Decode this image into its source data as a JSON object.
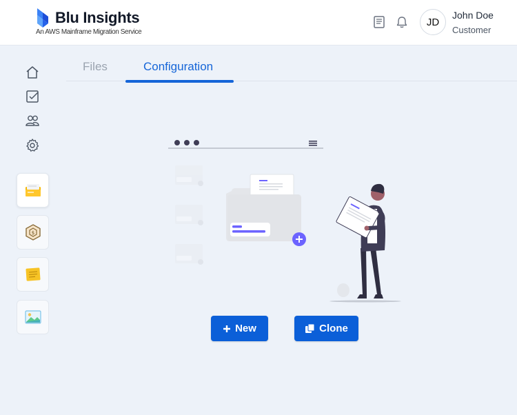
{
  "brand": {
    "title": "Blu Insights",
    "subtitle": "An AWS Mainframe Migration Service"
  },
  "header": {
    "icons": [
      "book-icon",
      "bell-icon"
    ],
    "user": {
      "initials": "JD",
      "name": "John Doe",
      "role": "Customer"
    }
  },
  "sidebar": {
    "nav_icons": [
      "home-icon",
      "checklist-icon",
      "users-icon",
      "gear-icon"
    ],
    "tiles": [
      "codebase-folder-icon",
      "hexagon-badge-icon",
      "notes-icon",
      "image-icon"
    ]
  },
  "tabs": [
    {
      "label": "Files",
      "active": false
    },
    {
      "label": "Configuration",
      "active": true
    }
  ],
  "actions": {
    "new_label": "New",
    "clone_label": "Clone"
  },
  "colors": {
    "primary": "#0b5fd8",
    "tab_active": "#1565d8",
    "background": "#edf2f9"
  }
}
